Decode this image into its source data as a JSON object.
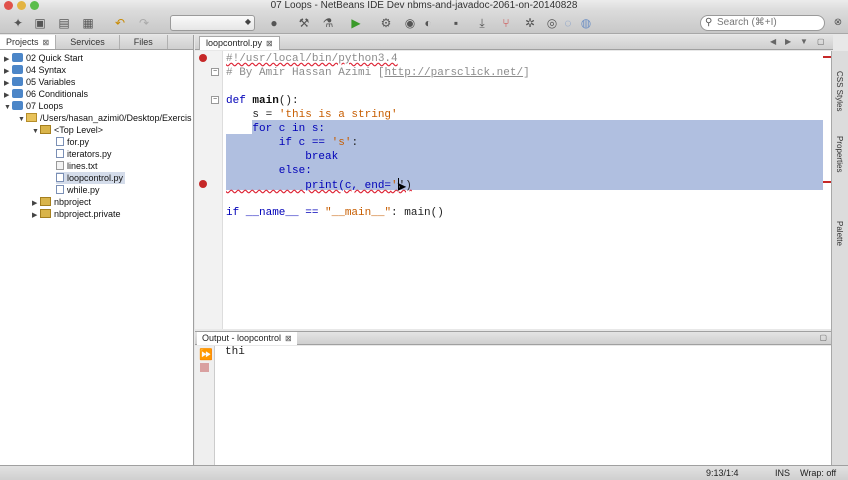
{
  "window": {
    "title": "07 Loops - NetBeans IDE Dev nbms-and-javadoc-2061-on-20140828"
  },
  "toolbar": {
    "search_placeholder": "Search (⌘+I)"
  },
  "left_panel": {
    "tabs": [
      "Projects",
      "Services",
      "Files"
    ],
    "tree": [
      {
        "label": "02 Quick Start",
        "type": "proj",
        "expanded": false
      },
      {
        "label": "04 Syntax",
        "type": "proj",
        "expanded": false
      },
      {
        "label": "05 Variables",
        "type": "proj",
        "expanded": false
      },
      {
        "label": "06 Conditionals",
        "type": "proj",
        "expanded": false
      },
      {
        "label": "07 Loops",
        "type": "proj",
        "expanded": true
      },
      {
        "label": "/Users/hasan_azimi0/Desktop/Exercis",
        "type": "folder",
        "expanded": true
      },
      {
        "label": "<Top Level>",
        "type": "pkg",
        "expanded": true
      },
      {
        "label": "for.py",
        "type": "py"
      },
      {
        "label": "iterators.py",
        "type": "py"
      },
      {
        "label": "lines.txt",
        "type": "file"
      },
      {
        "label": "loopcontrol.py",
        "type": "py",
        "selected": true
      },
      {
        "label": "while.py",
        "type": "py"
      },
      {
        "label": "nbproject",
        "type": "pkg",
        "expanded": false
      },
      {
        "label": "nbproject.private",
        "type": "pkg",
        "expanded": false
      }
    ]
  },
  "editor": {
    "tab_label": "loopcontrol.py",
    "lines": {
      "l1": "#!/usr/local/bin/python3.4",
      "l2_prefix": "# By Amir Hassan Azimi [",
      "l2_link": "http://parsclick.net/",
      "l2_suffix": "]",
      "l4_kw": "def",
      "l4_name": "main",
      "l4_rest": "():",
      "l5_var": "    s = ",
      "l5_str": "'this is a string'",
      "l6": "    for c in s:",
      "l7_a": "        if c == ",
      "l7_str": "'s'",
      "l7_b": ":",
      "l8": "            break",
      "l9": "        else:",
      "l10_a": "            print(c, end=",
      "l10_str": "'",
      "l10_b": "')",
      "l12_a": "if __name__ == ",
      "l12_str": "\"__main__\"",
      "l12_b": ": main()"
    }
  },
  "right_strip": [
    "CSS Styles",
    "Properties",
    "Palette"
  ],
  "output": {
    "tab_label": "Output - loopcontrol",
    "text": "thi"
  },
  "status": {
    "position": "9:13/1:4",
    "mode": "INS",
    "wrap": "Wrap: off"
  },
  "colors": {
    "selection": "#b0bfe0",
    "error": "#c62828",
    "keyword": "#0000b8",
    "string": "#c75d00"
  }
}
